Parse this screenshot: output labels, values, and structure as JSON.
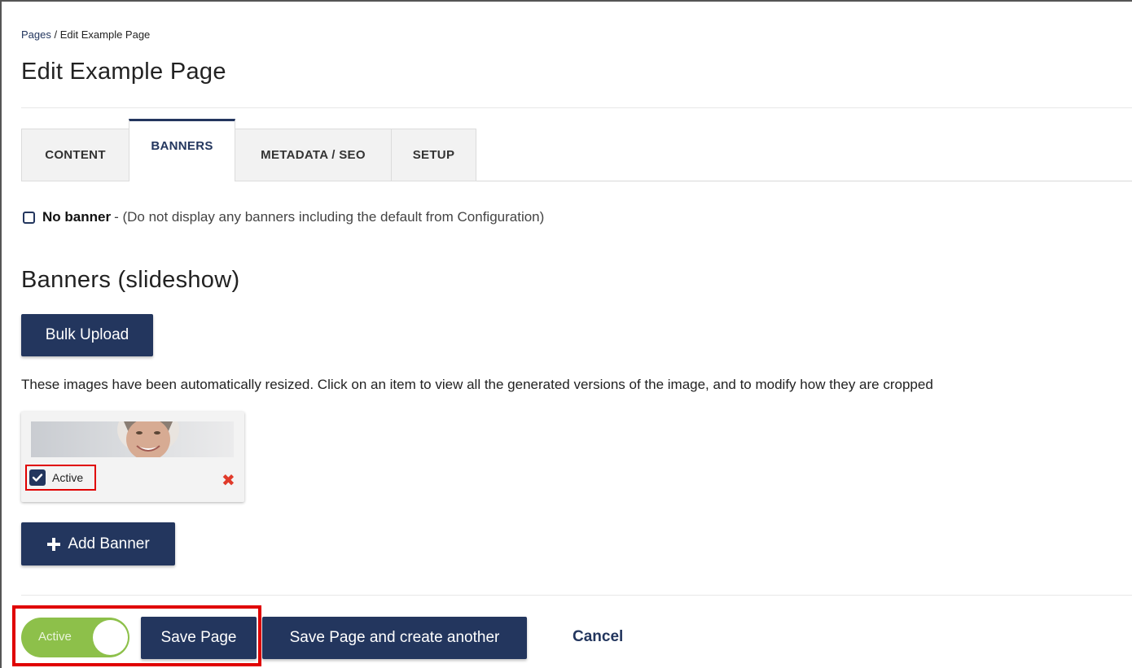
{
  "breadcrumb": {
    "parent": "Pages",
    "separator": " / ",
    "current": "Edit Example Page"
  },
  "page_title": "Edit Example Page",
  "tabs": [
    {
      "label": "CONTENT",
      "active": false
    },
    {
      "label": "BANNERS",
      "active": true
    },
    {
      "label": "METADATA / SEO",
      "active": false
    },
    {
      "label": "SETUP",
      "active": false
    }
  ],
  "no_banner": {
    "checked": false,
    "label": "No banner",
    "description": "- (Do not display any banners including the default from Configuration)"
  },
  "banners_section": {
    "title": "Banners (slideshow)",
    "bulk_upload_label": "Bulk Upload",
    "help_text": "These images have been automatically resized. Click on an item to view all the generated versions of the image, and to modify how they are cropped",
    "items": [
      {
        "active_label": "Active",
        "active": true
      }
    ],
    "add_banner_label": "Add Banner"
  },
  "footer": {
    "status_toggle_label": "Active",
    "status_on": true,
    "save_label": "Save Page",
    "save_another_label": "Save Page and create another",
    "cancel_label": "Cancel"
  },
  "colors": {
    "primary": "#23365e",
    "toggle_on": "#8dc04a",
    "highlight": "#e00000",
    "delete": "#e03a2a"
  },
  "icons": [
    "checkbox-icon",
    "checkmark-icon",
    "close-icon",
    "plus-icon"
  ]
}
